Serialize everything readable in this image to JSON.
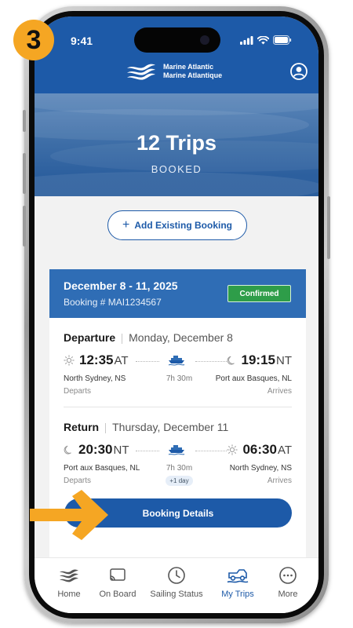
{
  "step_number": "3",
  "status_bar": {
    "time": "9:41"
  },
  "brand": {
    "line1": "Marine Atlantic",
    "line2": "Marine Atlantique"
  },
  "banner": {
    "title": "12 Trips",
    "subtitle": "BOOKED"
  },
  "actions": {
    "add_booking": "Add Existing Booking",
    "add_icon": "+",
    "booking_details": "Booking Details"
  },
  "booking": {
    "dates": "December 8 - 11, 2025",
    "number": "Booking # MAI1234567",
    "status": "Confirmed",
    "departure": {
      "label": "Departure",
      "day": "Monday, December 8",
      "depart_time": "12:35",
      "depart_zone": "AT",
      "arrive_time": "19:15",
      "arrive_zone": "NT",
      "duration": "7h 30m",
      "from": "North Sydney, NS",
      "to": "Port aux Basques, NL",
      "departs_label": "Departs",
      "arrives_label": "Arrives",
      "depart_icon": "sun-icon",
      "arrive_icon": "moon-icon"
    },
    "return": {
      "label": "Return",
      "day": "Thursday, December 11",
      "depart_time": "20:30",
      "depart_zone": "NT",
      "arrive_time": "06:30",
      "arrive_zone": "AT",
      "duration": "7h 30m",
      "extra_day": "+1 day",
      "from": "Port aux Basques, NL",
      "to": "North Sydney, NS",
      "departs_label": "Departs",
      "arrives_label": "Arrives",
      "depart_icon": "moon-icon",
      "arrive_icon": "sun-icon"
    }
  },
  "tabs": [
    {
      "label": "Home",
      "icon": "waves-icon",
      "active": false
    },
    {
      "label": "On Board",
      "icon": "cast-icon",
      "active": false
    },
    {
      "label": "Sailing Status",
      "icon": "clock-icon",
      "active": false
    },
    {
      "label": "My Trips",
      "icon": "car-ferry-icon",
      "active": true
    },
    {
      "label": "More",
      "icon": "ellipsis-icon",
      "active": false
    }
  ],
  "colors": {
    "brand_blue": "#1d5aa8",
    "confirmed_green": "#2e9d49",
    "highlight_orange": "#f5a623"
  }
}
